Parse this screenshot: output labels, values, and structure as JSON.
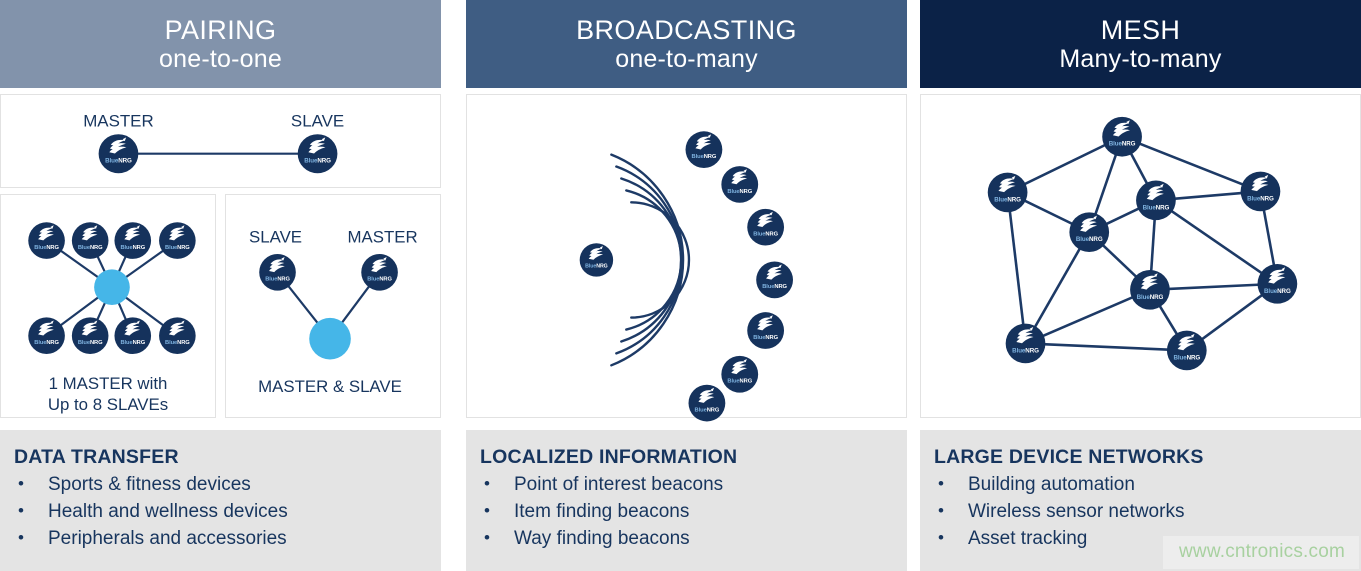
{
  "columns": [
    {
      "id": "pairing",
      "header": {
        "title": "PAIRING",
        "subtitle": "one-to-one",
        "bg": "#8293ab"
      },
      "labels": {
        "master": "MASTER",
        "slave": "SLAVE",
        "star_caption_line1": "1 MASTER with",
        "star_caption_line2": "Up to 8 SLAVEs",
        "tri_slave": "SLAVE",
        "tri_master": "MASTER",
        "tri_caption": "MASTER & SLAVE"
      },
      "info": {
        "heading": "DATA TRANSFER",
        "bullet": "•",
        "items": [
          "Sports & fitness devices",
          "Health and wellness devices",
          "Peripherals and accessories"
        ]
      }
    },
    {
      "id": "broadcasting",
      "header": {
        "title": "BROADCASTING",
        "subtitle": "one-to-many",
        "bg": "#3f5d83"
      },
      "info": {
        "heading": "LOCALIZED INFORMATION",
        "bullet": "•",
        "items": [
          "Point of interest beacons",
          "Item finding beacons",
          "Way finding beacons"
        ]
      }
    },
    {
      "id": "mesh",
      "header": {
        "title": "MESH",
        "subtitle": "Many-to-many",
        "bg": "#0b2247"
      },
      "info": {
        "heading": "LARGE DEVICE NETWORKS",
        "bullet": "•",
        "items": [
          "Building automation",
          "Wireless sensor networks",
          "Asset tracking"
        ]
      }
    }
  ],
  "node": {
    "label": "BlueNRG",
    "icon": "bluenrg-swoosh-icon"
  },
  "colors": {
    "node_fill": "#15325c",
    "hub_fill": "#45b6e8",
    "link": "#1d3a66",
    "panel_bg": "#e4e4e4",
    "text_navy": "#17355e",
    "watermark": "#a8d1a0"
  },
  "watermark": "www.cntronics.com",
  "chart_data": {
    "type": "diagram",
    "title": "Bluetooth Low Energy network topologies",
    "topologies": [
      {
        "name": "PAIRING",
        "relation": "one-to-one",
        "diagrams": [
          {
            "kind": "point-to-point",
            "nodes": 2,
            "hubs": 0,
            "links": 1
          },
          {
            "kind": "star",
            "nodes": 8,
            "hubs": 1,
            "links": 8,
            "caption": "1 MASTER with Up to 8 SLAVEs"
          },
          {
            "kind": "v-relay",
            "nodes": 2,
            "hubs": 1,
            "links": 2,
            "caption": "MASTER & SLAVE"
          }
        ]
      },
      {
        "name": "BROADCASTING",
        "relation": "one-to-many",
        "diagrams": [
          {
            "kind": "broadcast",
            "source_nodes": 1,
            "receiver_nodes": 7,
            "wave_arcs": 5
          }
        ]
      },
      {
        "name": "MESH",
        "relation": "Many-to-many",
        "diagrams": [
          {
            "kind": "mesh",
            "nodes": 9,
            "links": 18
          }
        ]
      }
    ]
  }
}
